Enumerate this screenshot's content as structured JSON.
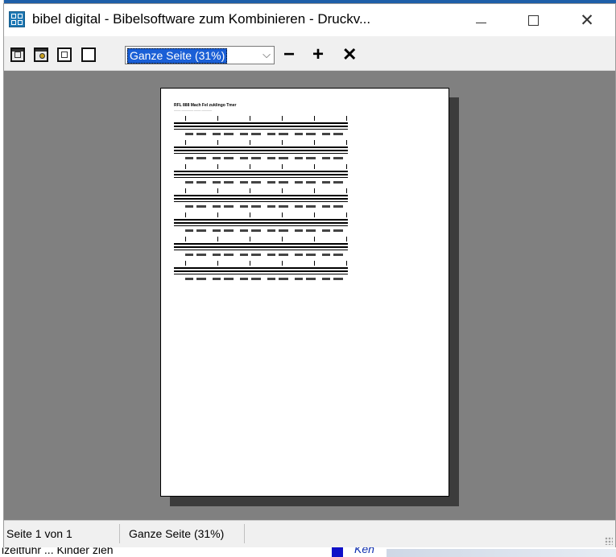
{
  "window": {
    "title": "bibel digital - Bibelsoftware zum Kombinieren - Druckv...",
    "app_icon": "grid-app-icon",
    "controls": {
      "minimize_icon": "minimize-icon",
      "maximize_icon": "maximize-icon",
      "close_icon": "close-icon"
    }
  },
  "toolbar": {
    "tools": [
      {
        "name": "print-icon"
      },
      {
        "name": "page-setup-icon"
      },
      {
        "name": "single-page-icon"
      },
      {
        "name": "full-page-icon"
      }
    ],
    "zoom": {
      "selected": "Ganze Seite (31%)",
      "arrow": "⌵"
    },
    "zoom_out_label": "−",
    "zoom_in_label": "+",
    "close_label": "✕"
  },
  "preview": {
    "page_title": "RFL 888 Mach Fel zuklingo Tmer",
    "page_subtitle": "──── ─────── ──── ──────",
    "staff_count": 7,
    "background_color": "#808080"
  },
  "status": {
    "page_info": "Seite 1 von 1",
    "zoom_info": "Ganze Seite (31%)"
  },
  "background_app": {
    "bottom_text": "izeitführ ... Kinder zieh",
    "bottom_ref": "Ken"
  },
  "colors": {
    "accent": "#1a5fd6",
    "window_bg": "#f0f0f0",
    "preview_bg": "#808080"
  }
}
